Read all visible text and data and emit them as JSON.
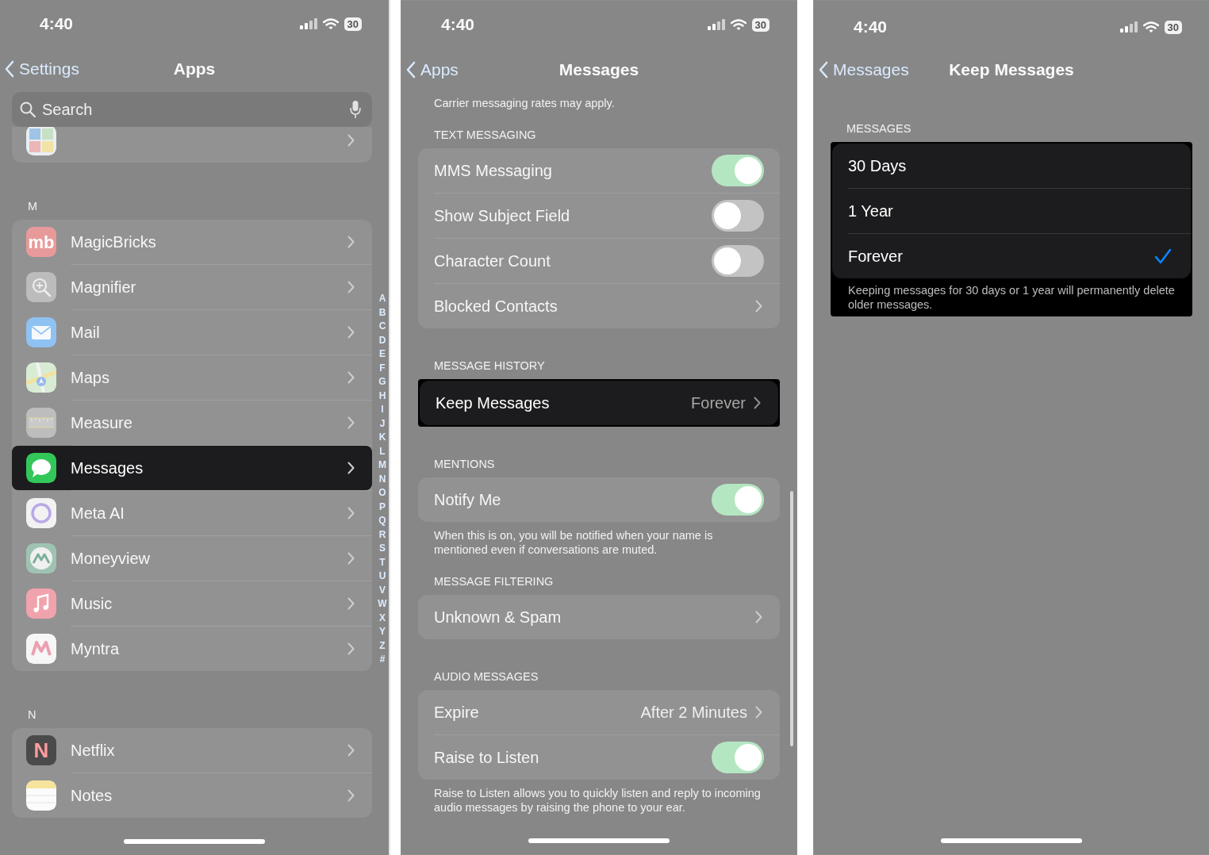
{
  "panels": [
    {
      "status_bar": {
        "time": "4:40",
        "battery": "30"
      },
      "nav": {
        "back": "Settings",
        "title": "Apps"
      },
      "search": {
        "placeholder": "Search"
      },
      "blocks": [
        {
          "kind": "group",
          "highlighted": false,
          "clipped": true,
          "rows": [
            {
              "kind": "app",
              "highlighted": false
            }
          ]
        },
        {
          "kind": "header",
          "text": "M"
        },
        {
          "kind": "group",
          "highlighted": false,
          "rows": [
            {
              "kind": "app",
              "label": "MagicBricks",
              "icon_text": "mb",
              "highlighted": false
            },
            {
              "kind": "app",
              "label": "Magnifier",
              "highlighted": false
            },
            {
              "kind": "app",
              "label": "Mail",
              "highlighted": false
            },
            {
              "kind": "app",
              "label": "Maps",
              "highlighted": false
            },
            {
              "kind": "app",
              "label": "Measure",
              "highlighted": false
            },
            {
              "kind": "app",
              "label": "Messages",
              "highlighted": true
            },
            {
              "kind": "app",
              "label": "Meta AI",
              "highlighted": false
            },
            {
              "kind": "app",
              "label": "Moneyview",
              "highlighted": false
            },
            {
              "kind": "app",
              "label": "Music",
              "highlighted": false
            },
            {
              "kind": "app",
              "label": "Myntra",
              "highlighted": false
            }
          ]
        },
        {
          "kind": "header",
          "text": "N"
        },
        {
          "kind": "group",
          "highlighted": false,
          "rows": [
            {
              "kind": "app",
              "label": "Netflix",
              "icon_text": "N",
              "highlighted": false
            },
            {
              "kind": "app",
              "label": "Notes",
              "highlighted": false
            }
          ]
        }
      ],
      "index": [
        "A",
        "B",
        "C",
        "D",
        "E",
        "F",
        "G",
        "H",
        "I",
        "J",
        "K",
        "L",
        "M",
        "N",
        "O",
        "P",
        "Q",
        "R",
        "S",
        "T",
        "U",
        "V",
        "W",
        "X",
        "Y",
        "Z",
        "#"
      ]
    },
    {
      "status_bar": {
        "time": "4:40",
        "battery": "30"
      },
      "nav": {
        "back": "Apps",
        "title": "Messages"
      },
      "scroll_indicator": true,
      "blocks": [
        {
          "kind": "footer",
          "text": "Carrier messaging rates may apply."
        },
        {
          "kind": "header",
          "text": "TEXT MESSAGING"
        },
        {
          "kind": "group",
          "highlighted": false,
          "rows": [
            {
              "kind": "toggle",
              "label": "MMS Messaging",
              "on": true
            },
            {
              "kind": "toggle",
              "label": "Show Subject Field",
              "on": false
            },
            {
              "kind": "toggle",
              "label": "Character Count",
              "on": false
            },
            {
              "kind": "link",
              "label": "Blocked Contacts"
            }
          ]
        },
        {
          "kind": "header",
          "text": "MESSAGE HISTORY"
        },
        {
          "kind": "group",
          "highlighted": true,
          "rows": [
            {
              "kind": "link",
              "label": "Keep Messages",
              "value": "Forever"
            }
          ]
        },
        {
          "kind": "header",
          "text": "MENTIONS"
        },
        {
          "kind": "group",
          "highlighted": false,
          "rows": [
            {
              "kind": "toggle",
              "label": "Notify Me",
              "on": true
            }
          ]
        },
        {
          "kind": "footer",
          "text": "When this is on, you will be notified when your name is mentioned even if conversations are muted."
        },
        {
          "kind": "header",
          "text": "MESSAGE FILTERING"
        },
        {
          "kind": "group",
          "highlighted": false,
          "rows": [
            {
              "kind": "link",
              "label": "Unknown & Spam"
            }
          ]
        },
        {
          "kind": "header",
          "text": "AUDIO MESSAGES"
        },
        {
          "kind": "group",
          "highlighted": false,
          "rows": [
            {
              "kind": "link",
              "label": "Expire",
              "value": "After 2 Minutes"
            },
            {
              "kind": "toggle",
              "label": "Raise to Listen",
              "on": true
            }
          ]
        },
        {
          "kind": "footer",
          "text": "Raise to Listen allows you to quickly listen and reply to incoming audio messages by raising the phone to your ear."
        }
      ]
    },
    {
      "status_bar": {
        "time": "4:40",
        "battery": "30"
      },
      "nav": {
        "back": "Messages",
        "title": "Keep Messages"
      },
      "blocks": [
        {
          "kind": "header",
          "text": "MESSAGES"
        },
        {
          "kind": "group",
          "highlighted": true,
          "rows": [
            {
              "kind": "option",
              "label": "30 Days",
              "selected": false
            },
            {
              "kind": "option",
              "label": "1 Year",
              "selected": false
            },
            {
              "kind": "option",
              "label": "Forever",
              "selected": true
            }
          ],
          "footer": "Keeping messages for 30 days or 1 year will permanently delete older messages."
        }
      ]
    }
  ]
}
